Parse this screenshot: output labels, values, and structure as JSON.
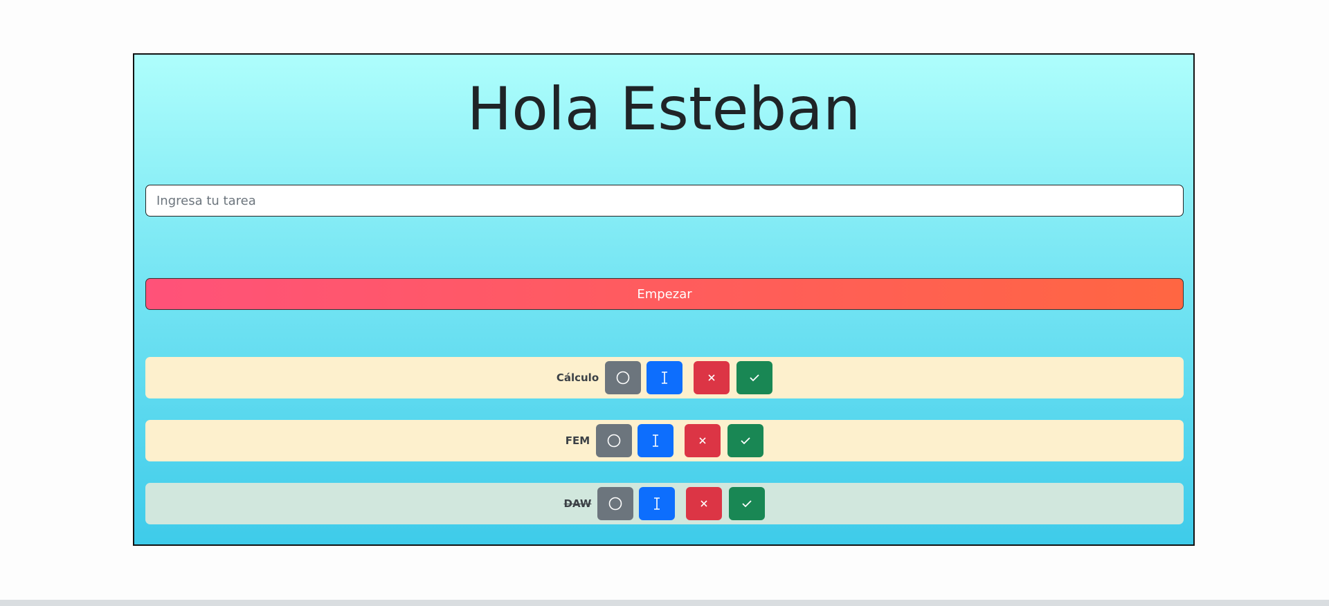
{
  "header": {
    "title": "Hola Esteban"
  },
  "task_input": {
    "placeholder": "Ingresa tu tarea",
    "value": ""
  },
  "start_button": {
    "label": "Empezar"
  },
  "tasks": [
    {
      "label": "Cálculo",
      "status": "pending",
      "background": "#fdf0cd"
    },
    {
      "label": "FEM",
      "status": "pending",
      "background": "#fdf0cd"
    },
    {
      "label": "DAW",
      "status": "completed",
      "background": "#d1e7dd"
    }
  ],
  "task_actions": [
    {
      "icon": "circle-icon",
      "color": "#6c757d"
    },
    {
      "icon": "text-cursor-icon",
      "color": "#0d6efd"
    },
    {
      "icon": "close-icon",
      "color": "#dc3545"
    },
    {
      "icon": "check-icon",
      "color": "#198754"
    }
  ],
  "colors": {
    "card_gradient_top": "#aefefc",
    "card_gradient_bottom": "#3ecbea",
    "start_gradient_left": "#ff5279",
    "start_gradient_right": "#ff6642"
  }
}
